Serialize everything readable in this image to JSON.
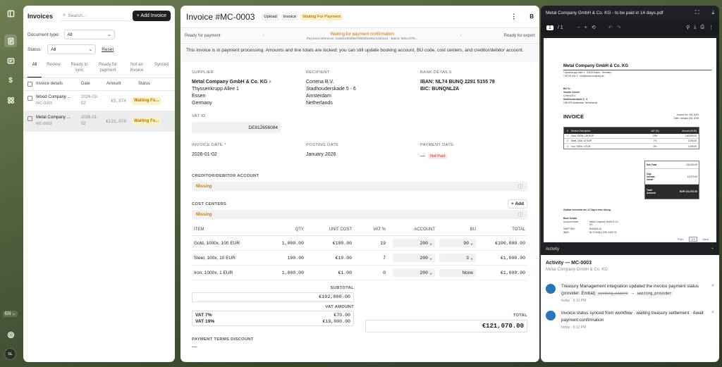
{
  "rail": {
    "language": "EN",
    "avatar_initials": "SL"
  },
  "list": {
    "title": "Invoices",
    "search_placeholder": "Search...",
    "add_label": "+ Add Invoice",
    "doctype_label": "Document type:",
    "doctype_value": "All",
    "status_label": "Status:",
    "status_value": "All",
    "reset_label": "Reset",
    "tabs": [
      "All",
      "Review",
      "Ready to sync",
      "Ready for payment",
      "Not an Invoice",
      "Synced"
    ],
    "columns": {
      "details": "Invoice details",
      "date": "Date",
      "amount": "Amount",
      "status": "Status"
    },
    "rows": [
      {
        "name": "Wood Company ...",
        "number": "WC-0302",
        "date": "2026-03-02",
        "amount": "€5,874",
        "status": "Waiting Fo..."
      },
      {
        "name": "Metal Company ...",
        "number": "MC-0003",
        "date": "2026-01-02",
        "amount": "€121,070",
        "status": "Waiting Fo..."
      }
    ]
  },
  "invoice": {
    "title": "Invoice #MC-0003",
    "chips": [
      "Upload",
      "Invoice",
      "Waiting For Payment"
    ],
    "steps": {
      "left": "Ready for payment",
      "center": "Waiting for payment confirmation",
      "center_sub": "Payment reference: Ea0dce6fd99d755b5f4e9be1dd4ea1 · Batch: 6e0ccf7f8...",
      "right": "Ready for export"
    },
    "notice": "This invoice is in payment processing. Amounts and line totals are locked; you can still update booking account, BU code, cost centers, and creditor/debitor account.",
    "supplier": {
      "label": "SUPPLIER",
      "name": "Metal Company GmbH & Co. KG",
      "lines": [
        "Thyssenkrupp Allee 1",
        "Essen",
        "Germany"
      ]
    },
    "recipient": {
      "label": "RECIPIENT",
      "name": "Cortena B.V.",
      "lines": [
        "Stadhouderskade 5 - 6",
        "Amsterdam",
        "Netherlands"
      ]
    },
    "bank": {
      "label": "BANK DETAILS",
      "iban": "IBAN: NL74 BUNQ 2291 5155 78",
      "bic": "BIC: BUNQNL2A"
    },
    "vat_id": {
      "label": "VAT ID",
      "value": "DE812656084"
    },
    "invoice_date": {
      "label": "INVOICE DATE *",
      "value": "2026-01-02"
    },
    "posting_date": {
      "label": "POSTING DATE",
      "value": "January 2026"
    },
    "payment_date": {
      "label": "PAYMENT DATE:",
      "dash": "—",
      "badge": "Not Paid"
    },
    "creditor": {
      "label": "CREDITOR/DEBITOR ACCOUNT",
      "value": "Missing"
    },
    "cost_centers": {
      "label": "COST CENTERS",
      "add": "+ Add",
      "value": "Missing"
    },
    "columns": [
      "ITEM",
      "QTY",
      "UNIT COST",
      "VAT %",
      "ACCOUNT",
      "BU",
      "TOTAL"
    ],
    "items": [
      {
        "item": "Gold, 1000x, 100 EUR",
        "qty": "1,000.00",
        "unit": "€100.00",
        "vat": "19",
        "account": "200",
        "bu": "90",
        "total": "€100,000.00"
      },
      {
        "item": "Steel, 100x, 10 EUR",
        "qty": "100.00",
        "unit": "€10.00",
        "vat": "7",
        "account": "200",
        "bu": "3",
        "total": "€1,000.00"
      },
      {
        "item": "Iron, 1000x, 1 EUR",
        "qty": "1,000.00",
        "unit": "€1.00",
        "vat": "0",
        "account": "200",
        "bu": "None",
        "total": "€1,000.00"
      }
    ],
    "subtotal_label": "SUBTOTAL",
    "subtotal": "€102,000.00",
    "vat_amount_label": "VAT AMOUNT",
    "vat7_label": "VAT 7%",
    "vat7": "€70.00",
    "vat19_label": "VAT 19%",
    "vat19": "€19,000.00",
    "total_label": "TOTAL",
    "total": "€121,070.00",
    "terms_label": "PAYMENT TERMS DISCOUNT",
    "terms_value": "—"
  },
  "pdf": {
    "title": "Metal Company GmbH & Co. KG - to be paid in 14 days.pdf",
    "page": "1",
    "pages": "/ 1",
    "doc": {
      "company": "Metal Company GmbH & Co. KG",
      "addr": "Thyssenkrupp Allee 1 · 45143 Essen · Germany",
      "contact": "+49 201 844 0 · info@metal-company.de",
      "billto": "Bill To:",
      "person": "Sandra Connor",
      "firm": "Cortena B.V.",
      "street": "Stadhouderskade 5 - 6",
      "city": "1054 ES Amsterdam, Netherlands",
      "heading": "INVOICE",
      "invno": "Invoice No.: MC-0003",
      "invdate": "Date: January 2nd, 2026",
      "cols": [
        "#",
        "Service Description",
        "VAT (%)",
        "Amount (EUR)"
      ],
      "rows": [
        [
          "1",
          "Gold, 1000x, 100 EUR",
          "19%",
          "100,000.00"
        ],
        [
          "2",
          "Steel, 100x, 10 EUR",
          "7%",
          "1,000.00"
        ],
        [
          "3",
          "Iron, 1000x, 1 EUR",
          "0%",
          "1,000.00"
        ]
      ],
      "sub_label": "Sub Total",
      "sub": "102,000.00",
      "vat_label": "Zzgl. Umsatz-steuer",
      "vat": "19,070.00",
      "tot_label": "Total Amount",
      "tot": "EUR 121,070.00",
      "terms": "Zahlbar innerhalb von 14 Tagen ohne Abzug.",
      "bank_h": "Bank Details",
      "acc_label": "Account holder:",
      "acc": "Metal Company GmbH & Co. KG",
      "swift_label": "SWIFT/BIC:",
      "swift": "BUNQNL2A",
      "iban_label": "IBAN:",
      "iban": "NL74 BUNQ 2291 5155 78",
      "prev": "Prev",
      "pg": "1/2",
      "next": "Next"
    }
  },
  "activity": {
    "panel": "Activity",
    "title": "Activity — MC-0003",
    "subtitle": "Metal Company GmbH & Co. KG",
    "items": [
      {
        "text": "Treasury Management integration updated the invoice payment status (provider: Embat)",
        "old": "pending_export",
        "arrow": "→",
        "new": "waiting_provider",
        "time": "today · 9:12 PM"
      },
      {
        "text": "Invoice status synced from workflow · waiting treasury settlement · Await payment confirmation",
        "time": "today · 9:12 PM"
      }
    ]
  }
}
